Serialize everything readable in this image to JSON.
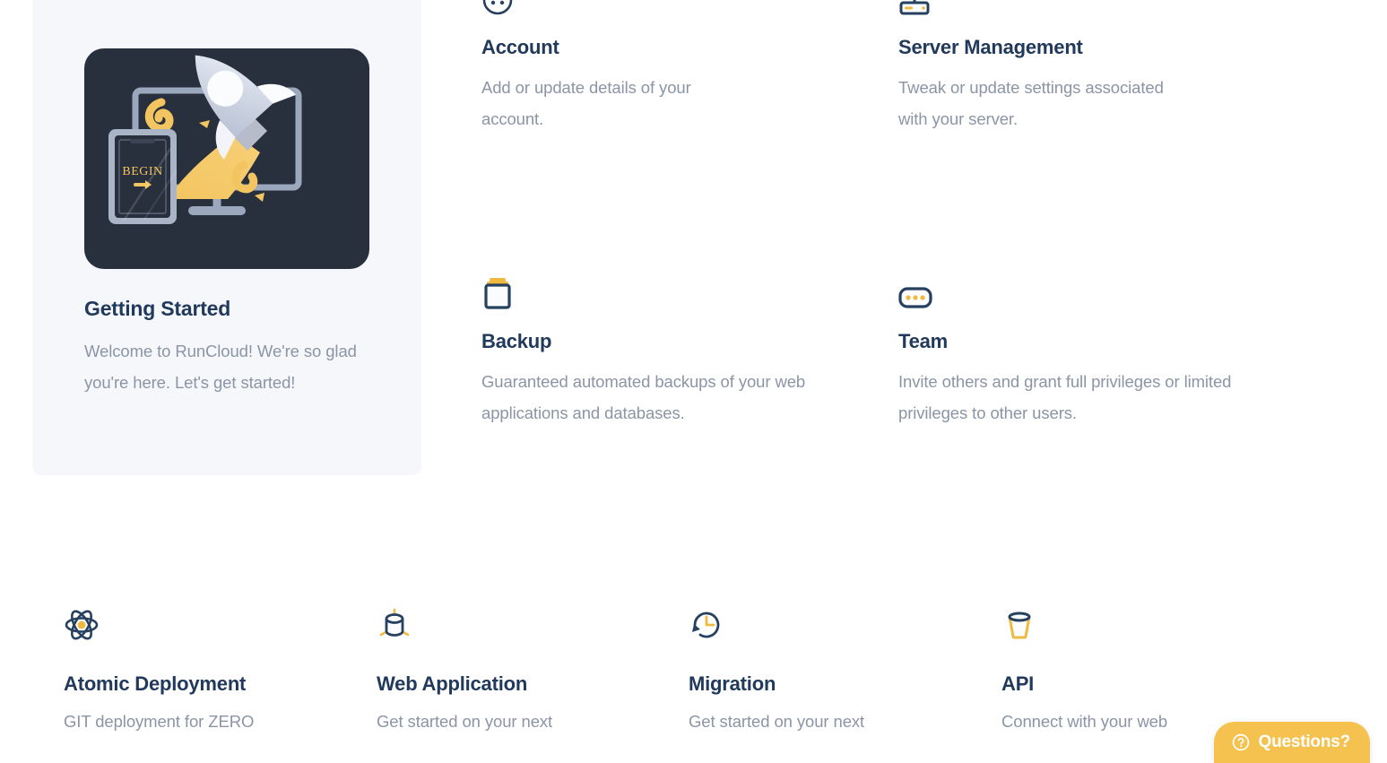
{
  "getting_started": {
    "title": "Getting Started",
    "description": "Welcome to RunCloud! We're so glad you're here. Let's get started!",
    "illustration": {
      "icon": "rocket-launch-illustration",
      "tablet_label": "BEGIN",
      "tablet_arrow": "arrow-right-icon"
    }
  },
  "features": [
    {
      "icon": "account-face-icon",
      "title": "Account",
      "description": "Add or update details of your account."
    },
    {
      "icon": "server-rack-icon",
      "title": "Server Management",
      "description": "Tweak or update settings associated with your server."
    },
    {
      "icon": "backup-clipboard-icon",
      "title": "Backup",
      "description": "Guaranteed automated backups of your web applications and databases."
    },
    {
      "icon": "team-dots-icon",
      "title": "Team",
      "description": "Invite others and grant full privileges or limited privileges to other users."
    }
  ],
  "bottom_features": [
    {
      "icon": "atom-icon",
      "title": "Atomic Deployment",
      "description": "GIT deployment for ZERO"
    },
    {
      "icon": "database-cylinder-icon",
      "title": "Web Application",
      "description": "Get started on your next"
    },
    {
      "icon": "clock-rewind-icon",
      "title": "Migration",
      "description": "Get started on your next"
    },
    {
      "icon": "bucket-icon",
      "title": "API",
      "description": "Connect with your web"
    }
  ],
  "questions_widget": {
    "icon": "question-circle-icon",
    "label": "Questions?"
  },
  "colors": {
    "heading": "#21395b",
    "body_text": "#8b95a5",
    "accent_yellow": "#f5c250",
    "icon_navy": "#26405f",
    "card_bg": "#f6f7fb",
    "illustration_bg": "#28303e",
    "page_bg": "#ffffff"
  }
}
